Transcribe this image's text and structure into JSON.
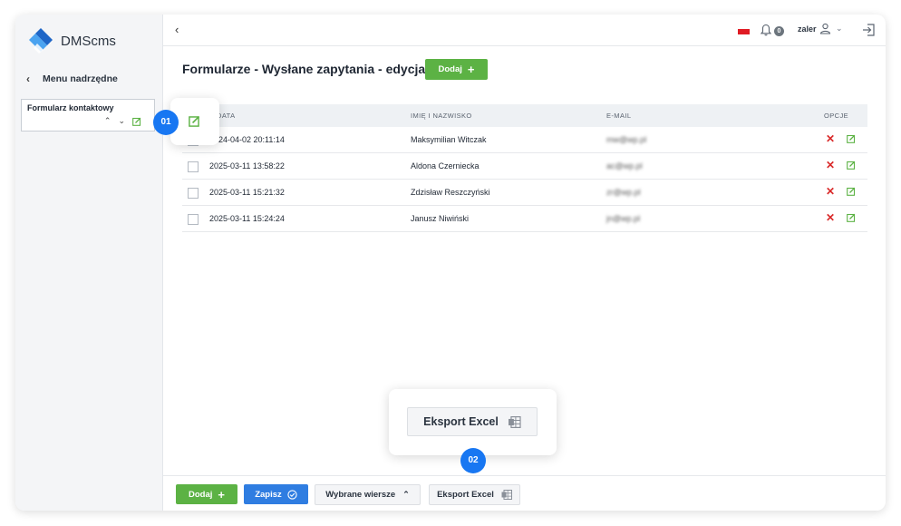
{
  "app": {
    "name": "DMScms"
  },
  "sidebar": {
    "back_label": "Menu nadrzędne",
    "card_title": "Formularz kontaktowy"
  },
  "topbar": {
    "notifications_count": "0",
    "user_name": "zaler",
    "flag_color": "#e01b24"
  },
  "page": {
    "title": "Formularze - Wysłane zapytania - edycja (7)",
    "add_label": "Dodaj"
  },
  "table": {
    "headers": {
      "date": "DATA",
      "name": "IMIĘ I NAZWISKO",
      "email": "E-MAIL",
      "options": "OPCJE"
    },
    "rows": [
      {
        "date": "2024-04-02 20:11:14",
        "name": "Maksymilian Witczak",
        "email": "mw@wp.pl"
      },
      {
        "date": "2025-03-11 13:58:22",
        "name": "Aldona Czerniecka",
        "email": "ac@wp.pl"
      },
      {
        "date": "2025-03-11 15:21:32",
        "name": "Zdzisław Reszczyński",
        "email": "zr@wp.pl"
      },
      {
        "date": "2025-03-11 15:24:24",
        "name": "Janusz Niwiński",
        "email": "jn@wp.pl"
      }
    ]
  },
  "bottombar": {
    "add_label": "Dodaj",
    "save_label": "Zapisz",
    "selected_rows_label": "Wybrane wiersze",
    "export_label": "Eksport Excel"
  },
  "callouts": {
    "one": "01",
    "two": "02",
    "export_label": "Eksport Excel"
  },
  "colors": {
    "green": "#5cb244",
    "blue": "#2f7de1",
    "callout_blue": "#1877f2",
    "delete_red": "#d92a2a"
  },
  "icons": [
    "logo-icon",
    "chevron-left-icon",
    "chevron-up-icon",
    "chevron-down-icon",
    "edit-icon",
    "bell-icon",
    "user-icon",
    "logout-icon",
    "plus-icon",
    "check-circle-icon",
    "excel-icon",
    "delete-icon"
  ]
}
